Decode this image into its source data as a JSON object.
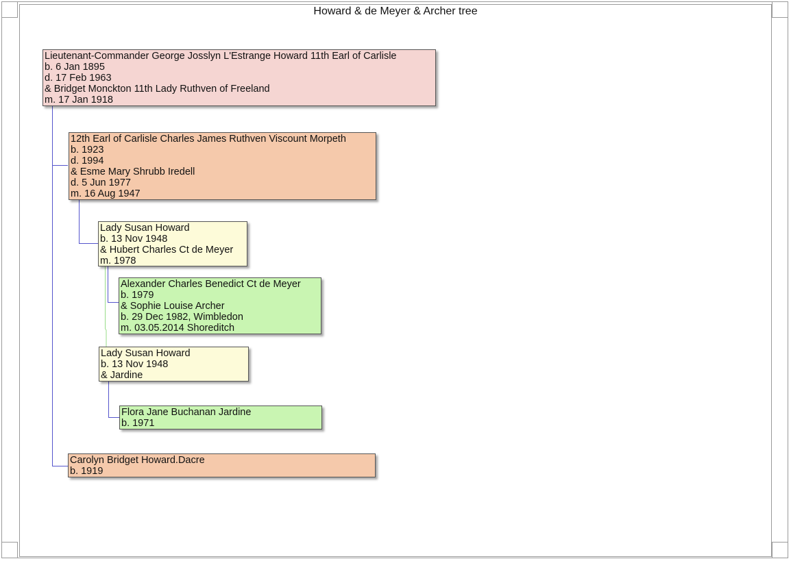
{
  "title": "Howard & de Meyer & Archer tree",
  "colors": {
    "root": "#f5d5d2",
    "generation2": "#f5c9ab",
    "generation3": "#fdfbd9",
    "generation4": "#c9f5b2",
    "link_main": "#5555cc",
    "link_alt": "#99dd88"
  },
  "people": {
    "george": [
      "Lieutenant-Commander George Josslyn L'Estrange Howard 11th Earl of Carlisle",
      "b. 6 Jan 1895",
      "d. 17 Feb 1963",
      "& Bridget Monckton 11th Lady Ruthven of Freeland",
      "m. 17 Jan 1918"
    ],
    "charles": [
      "12th Earl of Carlisle Charles James Ruthven Viscount Morpeth",
      "b. 1923",
      "d. 1994",
      "& Esme Mary Shrubb Iredell",
      "d. 5 Jun 1977",
      "m. 16 Aug 1947"
    ],
    "susan1": [
      "Lady Susan Howard",
      "b. 13 Nov 1948",
      "& Hubert Charles Ct de Meyer",
      "m. 1978"
    ],
    "alexander": [
      "Alexander Charles Benedict Ct de Meyer",
      "b. 1979",
      "& Sophie Louise Archer",
      "b. 29 Dec 1982, Wimbledon",
      "m. 03.05.2014 Shoreditch"
    ],
    "susan2": [
      "Lady Susan Howard",
      "b. 13 Nov 1948",
      "& Jardine"
    ],
    "flora": [
      "Flora Jane Buchanan Jardine",
      "b. 1971"
    ],
    "carolyn": [
      "Carolyn Bridget Howard.Dacre",
      "b. 1919"
    ]
  }
}
